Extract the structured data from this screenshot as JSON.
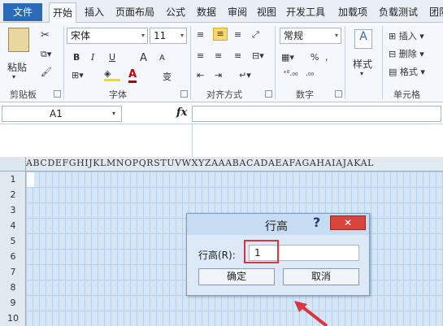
{
  "tabs": [
    "文件",
    "开始",
    "插入",
    "页面布局",
    "公式",
    "数据",
    "审阅",
    "视图",
    "开发工具",
    "加载项",
    "负载测试",
    "团队"
  ],
  "ribbon": {
    "clipboard": {
      "paste_label": "粘贴",
      "group_label": "剪贴板"
    },
    "font": {
      "name": "宋体",
      "size": "11",
      "group_label": "字体",
      "bold": "B",
      "italic": "I",
      "underline": "U",
      "grow": "A",
      "shrink": "A",
      "font_color": "A",
      "phonetic": "变"
    },
    "alignment": {
      "group_label": "对齐方式"
    },
    "number": {
      "format": "常规",
      "group_label": "数字",
      "percent": "%"
    },
    "styles": {
      "label": "样式"
    },
    "cells": {
      "insert": "插入",
      "delete": "删除",
      "format": "格式",
      "group_label": "单元格"
    }
  },
  "formula_bar": {
    "name_box": "A1",
    "fx": "fx",
    "value": ""
  },
  "sheet": {
    "columns": "ABCDEFGHIJKLMNOPQRSTUVWXYZAAABACADAEAFAGAHAIAJAKAL",
    "rows": [
      "1",
      "2",
      "3",
      "4",
      "5",
      "6",
      "7",
      "8",
      "9",
      "10"
    ]
  },
  "dialog": {
    "title": "行高",
    "help": "?",
    "close": "✕",
    "field_label": "行高(R):",
    "field_value": "1",
    "ok": "确定",
    "cancel": "取消"
  },
  "colors": {
    "highlight_box": "#d9363e",
    "annotation_arrow": "#d9363e",
    "file_tab": "#2a6ab8"
  }
}
